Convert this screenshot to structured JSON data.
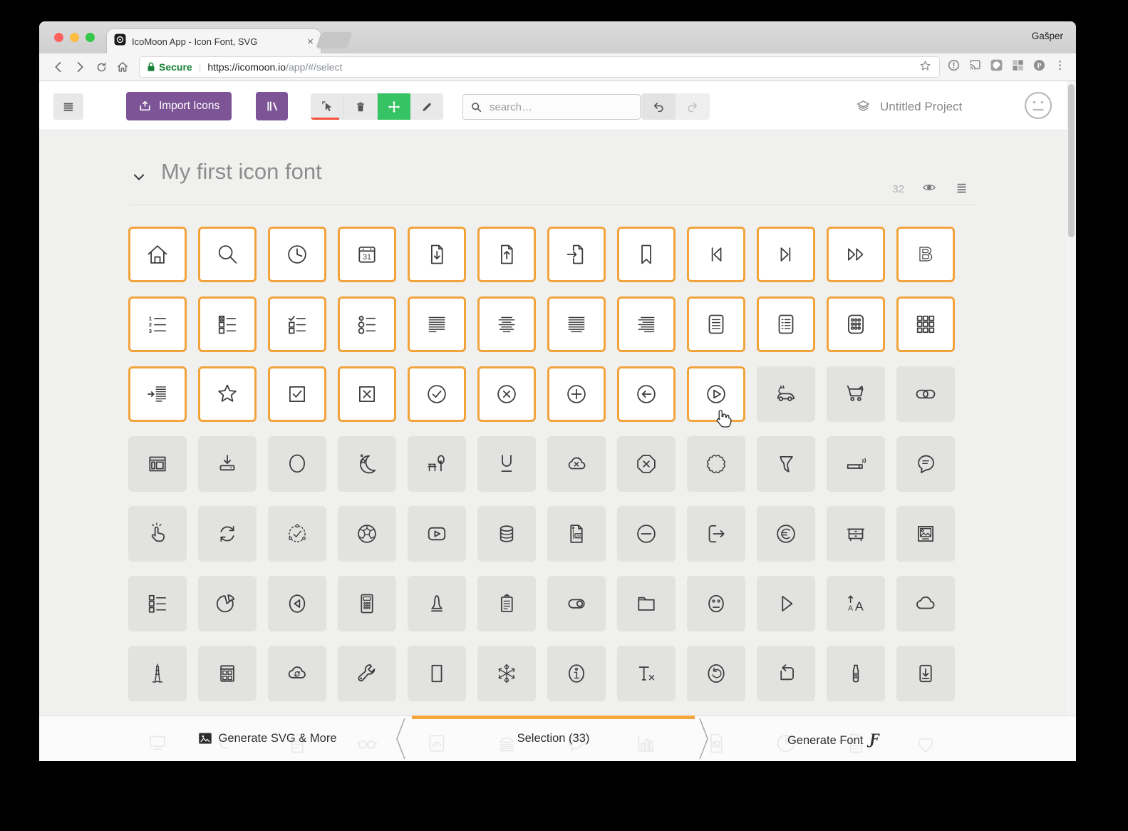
{
  "browser": {
    "tab_title": "IcoMoon App - Icon Font, SVG",
    "tab_close": "×",
    "profile_name": "Gašper",
    "security_label": "Secure",
    "url_separator": "|",
    "url_main": "https://icomoon.io",
    "url_path": "/app/#/select",
    "nav_icons": [
      "back-icon",
      "forward-icon",
      "reload-icon",
      "home-icon"
    ],
    "extension_icons": [
      "onepassword-icon",
      "cast-icon",
      "shape-extension-icon",
      "grid-extension-icon",
      "pinterest-icon",
      "menu-dots-icon"
    ]
  },
  "toolbar": {
    "import_label": "Import Icons",
    "search_placeholder": "search…",
    "project_name": "Untitled Project",
    "tool_icons": [
      "select-cursor-icon",
      "trash-icon",
      "move-icon",
      "pencil-icon"
    ],
    "colors": {
      "accent_purple": "#7d5596",
      "active_green": "#36c363",
      "tool_underline_red": "#f4503c"
    }
  },
  "set": {
    "title": "My first icon font",
    "count": "32"
  },
  "grid": {
    "selected_count": 33,
    "selected_border_color": "#f2a43c",
    "tiles": [
      "home",
      "search",
      "clock",
      "calendar",
      "file-download",
      "file-upload",
      "file-import",
      "bookmark",
      "skip-start",
      "skip-end",
      "fast-forward",
      "bold",
      "list-numbered",
      "list-checkbox",
      "list-tasks",
      "list-radio",
      "paragraph-left",
      "paragraph-center",
      "paragraph-justify",
      "paragraph-right",
      "document-text",
      "document-list",
      "keypad",
      "grid-squares",
      "indent",
      "star",
      "checkbox-checked",
      "checkbox-cross",
      "circle-check",
      "circle-cross",
      "circle-plus",
      "circle-arrow-left",
      "circle-play",
      "car-electric",
      "cart",
      "link",
      "browser-panel",
      "download-device",
      "circle-shape",
      "moon-stars",
      "park",
      "underline",
      "cloud-cross",
      "octagon-cross",
      "seal",
      "tornado",
      "cigarette",
      "comment-lines",
      "tap",
      "sync",
      "dotted-circle-check",
      "soccer",
      "video-play",
      "database",
      "file-zip",
      "circle-minus",
      "sign-out",
      "euro",
      "dresser",
      "image",
      "list-boxes",
      "pie-chart",
      "circle-previous",
      "calculator",
      "user-female",
      "clipboard-list",
      "toggle",
      "folder",
      "neutral-face",
      "play",
      "font-size",
      "cloud",
      "eiffel-tower",
      "table-window",
      "cloud-sync",
      "wrench",
      "rectangle",
      "snowflake",
      "info-circle",
      "text-remove",
      "undo-circle",
      "loop",
      "bottle",
      "box-download"
    ],
    "ghost_tiles": [
      "monitor",
      "arrow-return",
      "file-text",
      "glasses",
      "gauge",
      "burger",
      "speech-bubble",
      "bar-chart",
      "file-image",
      "pie",
      "file-lines",
      "heart"
    ]
  },
  "footer": {
    "left_label": "Generate SVG & More",
    "center_label": "Selection (33)",
    "right_label": "Generate Font",
    "fancy_f": "Ƒ"
  }
}
